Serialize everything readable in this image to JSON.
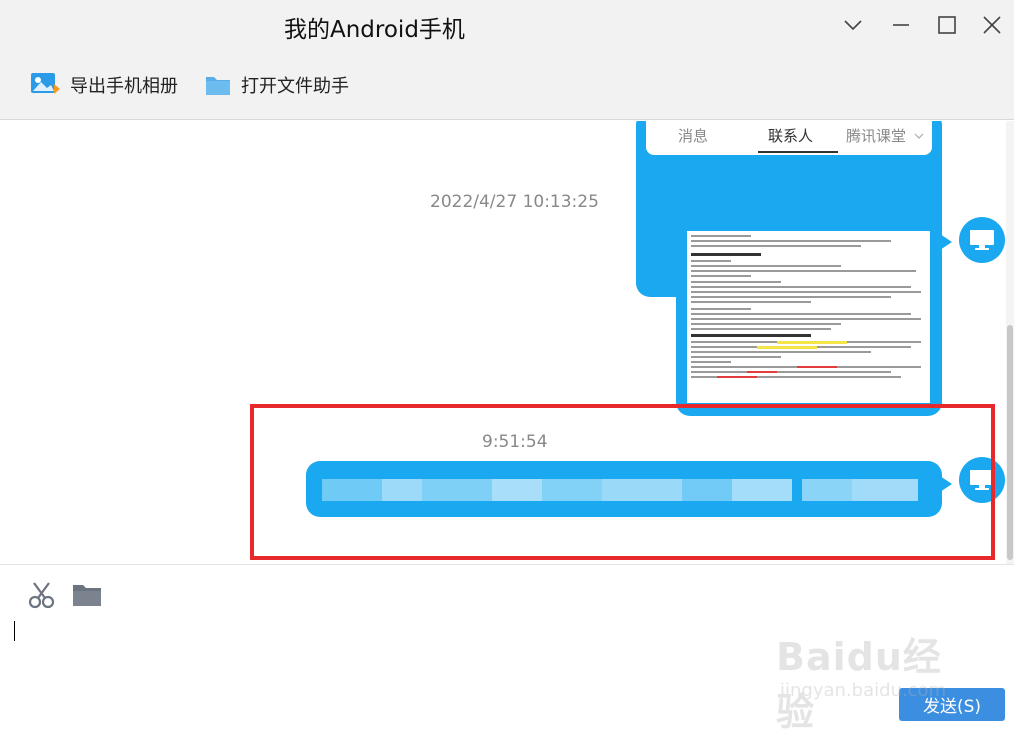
{
  "window": {
    "title": "我的Android手机"
  },
  "toolbar": {
    "export_label": "导出手机相册",
    "open_label": "打开文件助手"
  },
  "embedded_tabs": [
    {
      "label": "消息",
      "active": false
    },
    {
      "label": "联系人",
      "active": true
    },
    {
      "label": "腾讯课堂",
      "active": false
    }
  ],
  "messages": {
    "timestamp_1": "2022/4/27 10:13:25",
    "timestamp_2": "9:51:54"
  },
  "input": {
    "send_label": "发送(S)"
  },
  "watermark": {
    "logo": "Baidu经验",
    "url": "jingyan.baidu.com"
  },
  "colors": {
    "accent": "#1aa9f0",
    "highlight": "#e8292b",
    "send": "#3b8ee0"
  }
}
